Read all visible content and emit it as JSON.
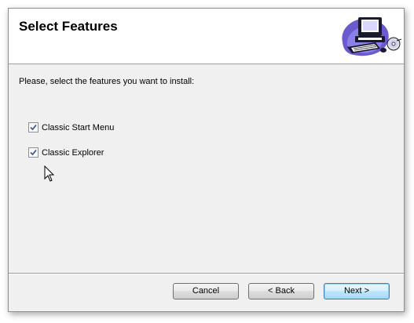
{
  "header": {
    "title": "Select Features",
    "art_icon": "computer-with-cd-icon"
  },
  "instructions": "Please, select the features you want to install:",
  "options": [
    {
      "label": "Classic Start Menu",
      "checked": true
    },
    {
      "label": "Classic Explorer",
      "checked": true
    }
  ],
  "buttons": {
    "cancel": "Cancel",
    "back": "< Back",
    "next": "Next >"
  },
  "colors": {
    "default_button_border": "#3c7fb1",
    "header_background": "#ffffff",
    "body_background": "#f0f0f0"
  }
}
